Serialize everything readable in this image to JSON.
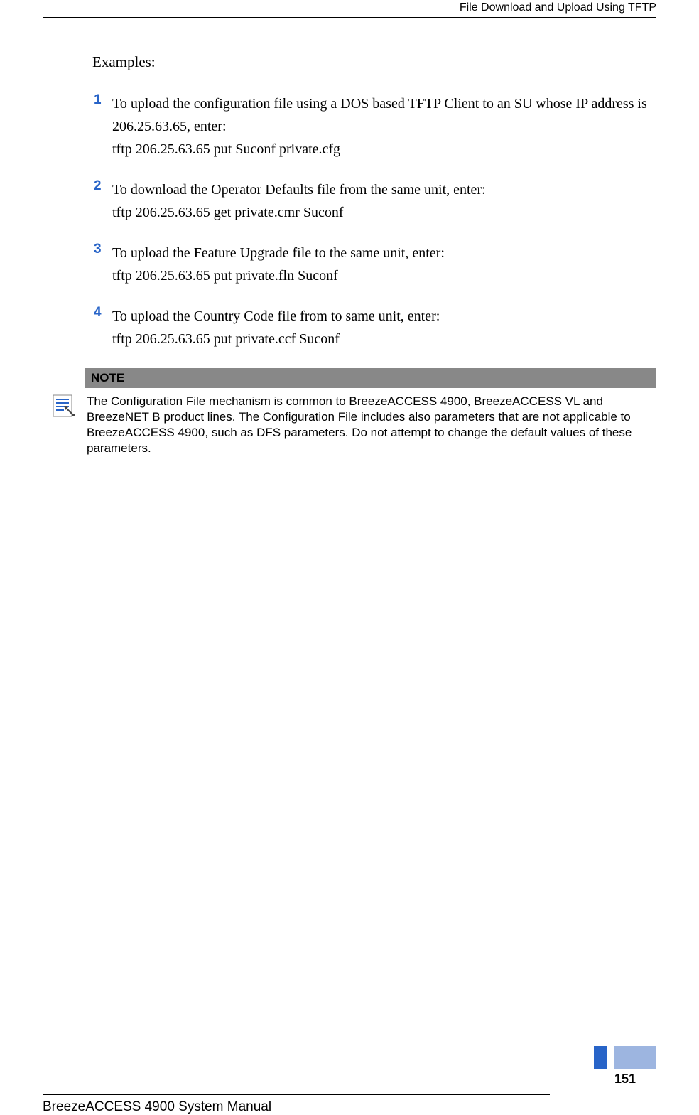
{
  "header": {
    "title": "File Download and Upload Using TFTP"
  },
  "content": {
    "heading": "Examples:",
    "examples": [
      {
        "num": "1",
        "line1": "To upload the configuration file using a DOS based TFTP Client to an SU whose IP address is 206.25.63.65, enter:",
        "line2": "tftp 206.25.63.65 put Suconf private.cfg"
      },
      {
        "num": "2",
        "line1": "To download the Operator Defaults file from the same unit, enter:",
        "line2": "tftp 206.25.63.65 get private.cmr Suconf"
      },
      {
        "num": "3",
        "line1": "To upload the Feature Upgrade file to the same unit, enter:",
        "line2": "tftp 206.25.63.65 put private.fln Suconf"
      },
      {
        "num": "4",
        "line1": "To upload the Country Code file from to same unit, enter:",
        "line2": "tftp 206.25.63.65 put private.ccf Suconf"
      }
    ],
    "note": {
      "header": "NOTE",
      "text": "The Configuration File mechanism is common to BreezeACCESS 4900, BreezeACCESS VL and BreezeNET B product lines. The Configuration File includes also parameters that are not applicable to BreezeACCESS 4900, such as DFS parameters. Do not attempt to change the default values of these parameters."
    }
  },
  "footer": {
    "manual_name": "BreezeACCESS 4900 System Manual",
    "page_number": "151"
  }
}
